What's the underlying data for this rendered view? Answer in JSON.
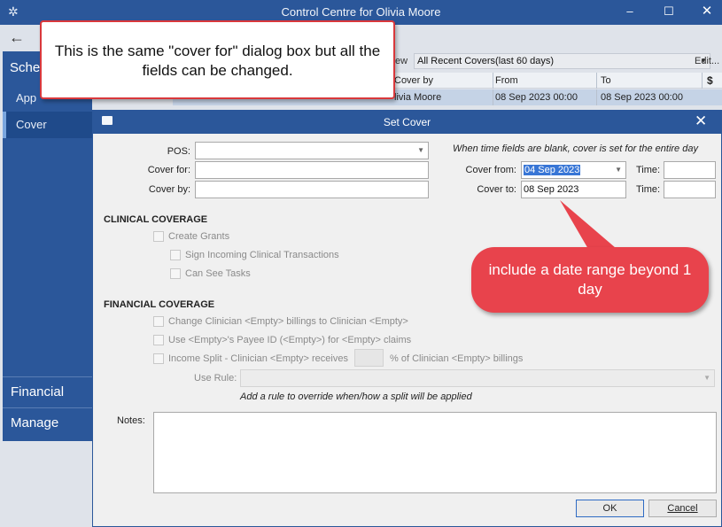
{
  "window": {
    "title": "Control Centre for Olivia Moore",
    "minimize": "–",
    "maximize": "☐",
    "close": "✕",
    "back": "←"
  },
  "sidebar": {
    "header": "Sche",
    "items": [
      {
        "label": "App"
      },
      {
        "label": "Cover"
      }
    ],
    "bottom": [
      {
        "label": "Financial"
      },
      {
        "label": "Manage"
      }
    ]
  },
  "view_bar": {
    "label": "ew",
    "selected": "All Recent Covers(last 60 days)",
    "edit": "Edit..."
  },
  "grid": {
    "headers": [
      "Cover by",
      "From",
      "To",
      "$"
    ],
    "row": [
      "livia Moore",
      "08 Sep 2023 00:00",
      "08 Sep 2023 00:00"
    ]
  },
  "dialog": {
    "title": "Set Cover",
    "close": "✕",
    "hint": "When time fields are blank, cover is set for the entire day",
    "pos_label": "POS:",
    "pos_value": "",
    "cover_for_label": "Cover for:",
    "cover_for_value": "",
    "cover_by_label": "Cover by:",
    "cover_by_value": "",
    "cover_from_label": "Cover from:",
    "cover_from_value": "04 Sep 2023",
    "cover_to_label": "Cover to:",
    "cover_to_value": "08 Sep 2023",
    "time_label": "Time:",
    "time_from_value": "",
    "time_to_value": "",
    "clinical": {
      "heading": "CLINICAL COVERAGE",
      "create_grants": "Create Grants",
      "sign_incoming": "Sign Incoming Clinical Transactions",
      "can_see_tasks": "Can See Tasks"
    },
    "financial": {
      "heading": "FINANCIAL COVERAGE",
      "change_clinician": "Change Clinician <Empty> billings to Clinician <Empty>",
      "use_payee": "Use <Empty>'s Payee ID (<Empty>) for <Empty> claims",
      "income_split": "Income Split - Clinician <Empty> receives",
      "income_split_suffix": "% of Clinician <Empty> billings",
      "use_rule_label": "Use Rule:",
      "rule_hint": "Add a rule to override when/how a split will be applied"
    },
    "notes_label": "Notes:",
    "ok": "OK",
    "cancel": "Cancel"
  },
  "annotations": {
    "top": "This is the same \"cover for\" dialog box but all the fields can be changed.",
    "red": "include a date range beyond 1 day",
    "colors": {
      "callout_fill": "#e8434c",
      "callout_border": "#d9383c",
      "accent": "#2b579a"
    }
  }
}
